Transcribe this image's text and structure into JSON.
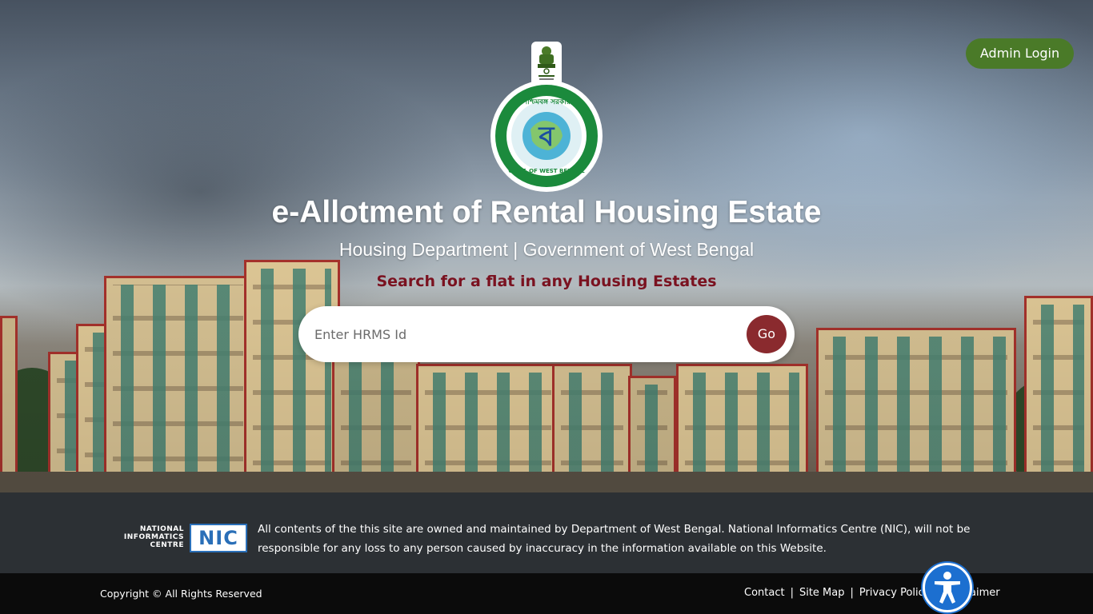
{
  "header": {
    "admin_login_label": "Admin Login"
  },
  "emblem": {
    "ashoka_icon": "ashoka-emblem-icon",
    "seal_icon": "west-bengal-seal-icon",
    "seal_top_text": "পশ্চিমবঙ্গ সরকার",
    "seal_center_text": "ব",
    "seal_bottom_text": "GOVT. OF WEST BENGAL"
  },
  "hero": {
    "title": "e-Allotment of Rental Housing Estate",
    "subtitle": "Housing Department | Government of West Bengal",
    "tagline_prefix": "Search for a flat in any ",
    "tagline_emphasis": "Housing Estates"
  },
  "search": {
    "placeholder": "Enter HRMS Id",
    "value": "",
    "go_label": "Go"
  },
  "footer": {
    "nic_logo_text": [
      "NATIONAL",
      "INFORMATICS",
      "CENTRE"
    ],
    "nic_mark": "NIC",
    "disclaimer": "All contents of the this site are owned and maintained by Department of West Bengal. National Informatics Centre (NIC), will not be responsible for any loss to any person caused by inaccuracy in the information available on this Website.",
    "copyright": "Copyright © All Rights Reserved",
    "links": [
      "Contact",
      "Site Map",
      "Privacy Policy",
      "Disclaimer"
    ],
    "separator": "|"
  },
  "accessibility": {
    "icon": "accessibility-icon"
  },
  "colors": {
    "admin_button": "#4a7a28",
    "go_button": "#8a2a2e",
    "tagline": "#7a1220",
    "footer_info_bg": "#2c3034",
    "footer_bar_bg": "#0b0b0b",
    "accessibility_button": "#1c6fd0"
  }
}
